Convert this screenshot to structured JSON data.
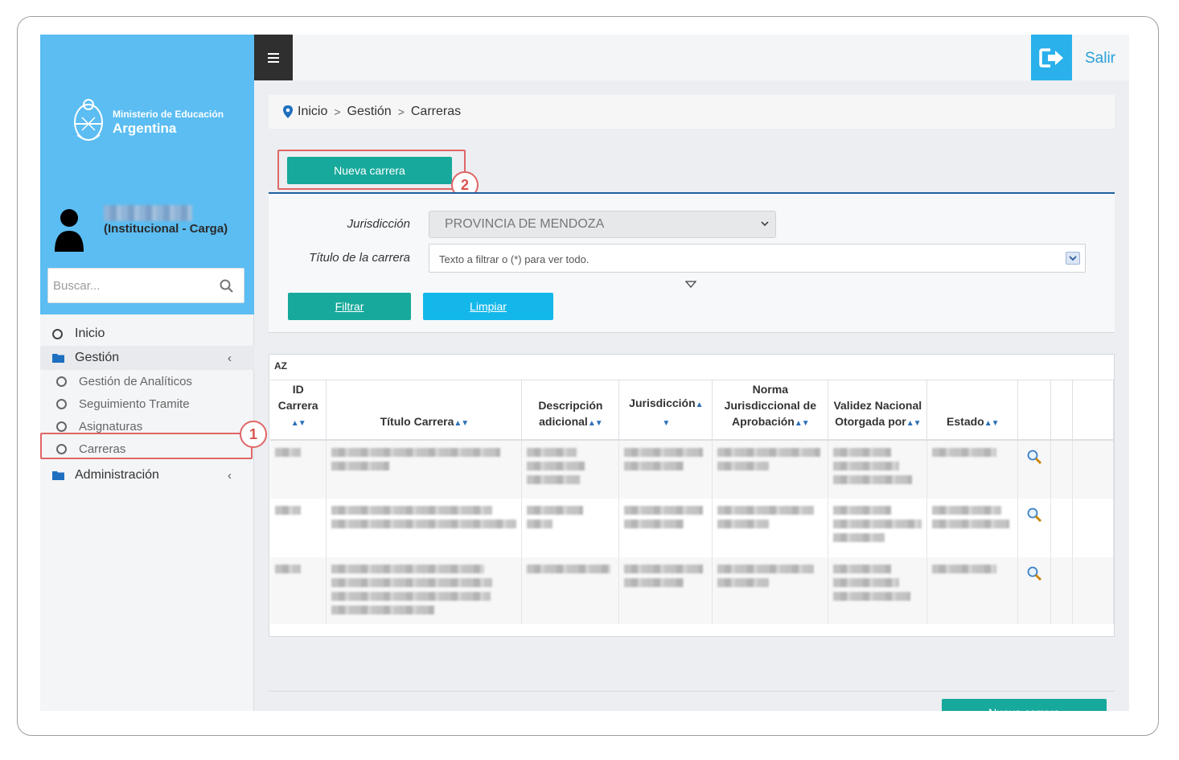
{
  "brand": {
    "line1": "Ministerio de Educación",
    "line2": "Argentina"
  },
  "user": {
    "role": "(Institucional - Carga)"
  },
  "sidebar": {
    "search_placeholder": "Buscar...",
    "items": [
      {
        "label": "Inicio",
        "icon": "circle-icon",
        "type": "item"
      },
      {
        "label": "Gestión",
        "icon": "folder-icon",
        "type": "group"
      },
      {
        "label": "Gestión de Analíticos",
        "icon": "circle-icon",
        "type": "sub"
      },
      {
        "label": "Seguimiento Tramite",
        "icon": "circle-icon",
        "type": "sub"
      },
      {
        "label": "Asignaturas",
        "icon": "circle-icon",
        "type": "sub"
      },
      {
        "label": "Carreras",
        "icon": "circle-icon",
        "type": "sub"
      },
      {
        "label": "Administración",
        "icon": "folder-icon",
        "type": "group"
      }
    ]
  },
  "topbar": {
    "exit_label": "Salir"
  },
  "breadcrumb": [
    "Inicio",
    "Gestión",
    "Carreras"
  ],
  "annotations": {
    "badge1": "1",
    "badge2": "2"
  },
  "actions": {
    "new_career": "Nueva carrera",
    "filter": "Filtrar",
    "clear": "Limpiar"
  },
  "filters": {
    "jurisdiction_label": "Jurisdicción",
    "jurisdiction_value": "PROVINCIA DE MENDOZA",
    "title_label": "Título de la carrera",
    "title_placeholder": "Texto a filtrar o (*) para ver todo."
  },
  "table": {
    "sort_icon_label": "AZ",
    "columns": {
      "id_line1": "ID",
      "id_line2": "Carrera",
      "titulo": "Título Carrera",
      "desc_line1": "Descripción",
      "desc_line2": "adicional",
      "jurisdiccion": "Jurisdicción",
      "norma_line1": "Norma",
      "norma_line2": "Jurisdiccional de",
      "norma_line3": "Aprobación",
      "validez_line1": "Validez Nacional",
      "validez_line2": "Otorgada por",
      "estado": "Estado"
    }
  },
  "colors": {
    "sidebar_header": "#5bbdf2",
    "teal": "#17a99b",
    "cyan": "#13b7ea",
    "annotation": "#e06666"
  }
}
